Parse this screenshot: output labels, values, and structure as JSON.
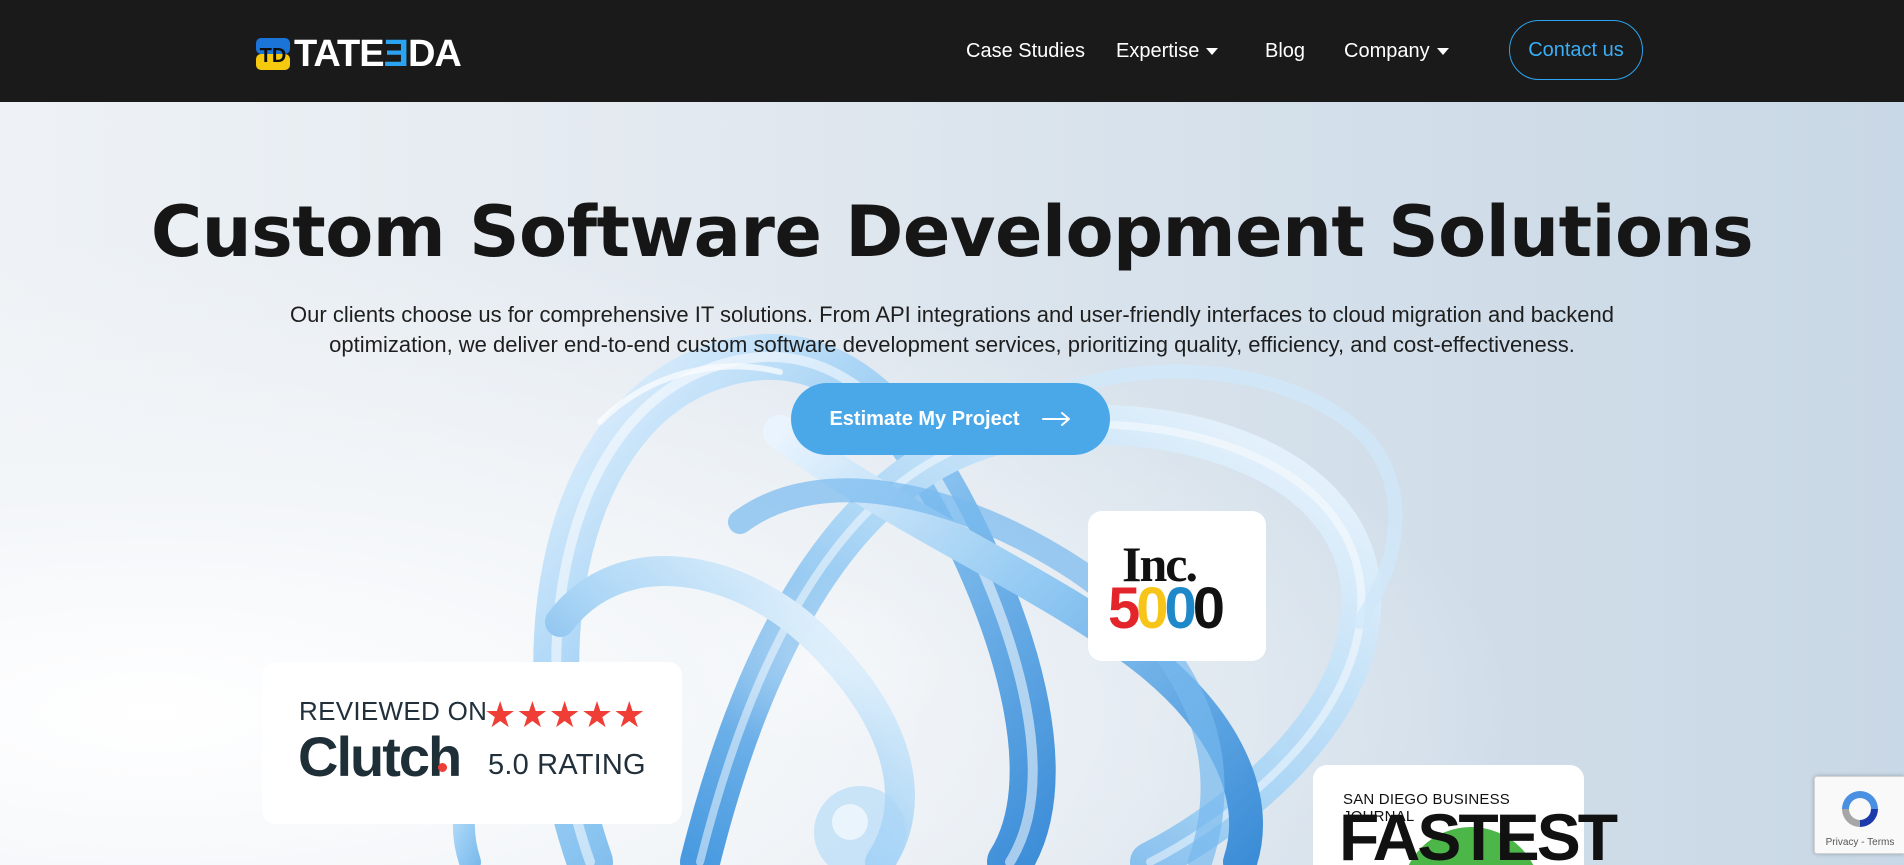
{
  "header": {
    "logo_text_a": "TATE",
    "logo_text_b": "Ǝ",
    "logo_text_c": "DA",
    "nav": [
      {
        "label": "Case Studies",
        "has_dropdown": false
      },
      {
        "label": "Expertise",
        "has_dropdown": true
      },
      {
        "label": "Blog",
        "has_dropdown": false
      },
      {
        "label": "Company",
        "has_dropdown": true
      }
    ],
    "contact_label": "Contact us"
  },
  "hero": {
    "title": "Custom Software Development Solutions",
    "subtitle": "Our clients choose us for comprehensive IT solutions. From API integrations and user-friendly interfaces to cloud migration and backend optimization, we deliver end-to-end custom software development services, prioritizing quality, efficiency, and cost-effectiveness.",
    "cta_label": "Estimate My Project"
  },
  "badges": {
    "clutch": {
      "reviewed": "REVIEWED ON",
      "name": "Clutch",
      "stars": "★★★★★",
      "rating": "5.0 RATING"
    },
    "inc": {
      "word": "Inc.",
      "digits": [
        "5",
        "0",
        "0",
        "0"
      ]
    },
    "sdbj": {
      "top": "SAN DIEGO BUSINESS JOURNAL",
      "big": "FASTEST"
    }
  },
  "recaptcha": {
    "links": "Privacy - Terms"
  },
  "colors": {
    "accent": "#2ba3f0",
    "cta": "#4aa8e8",
    "header_bg": "#1a1a1a",
    "star": "#ef3e36",
    "inc_digits": [
      "#e3242b",
      "#f7c518",
      "#1e88c9",
      "#111111"
    ]
  },
  "icons": [
    "arrow-right-icon",
    "caret-down-icon",
    "recaptcha-icon",
    "star-icon"
  ]
}
